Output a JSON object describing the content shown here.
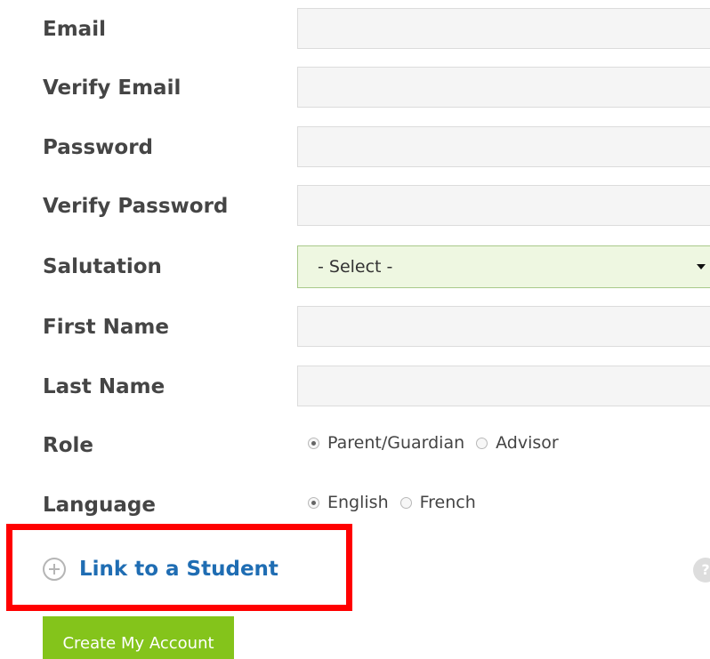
{
  "form": {
    "fields": {
      "email": {
        "label": "Email",
        "value": "",
        "placeholder": ""
      },
      "verify_email": {
        "label": "Verify Email",
        "value": "",
        "placeholder": ""
      },
      "password": {
        "label": "Password",
        "value": "",
        "placeholder": ""
      },
      "verify_password": {
        "label": "Verify Password",
        "value": "",
        "placeholder": ""
      },
      "salutation": {
        "label": "Salutation",
        "selected": "- Select -"
      },
      "first_name": {
        "label": "First Name",
        "value": "",
        "placeholder": ""
      },
      "last_name": {
        "label": "Last Name",
        "value": "",
        "placeholder": ""
      }
    },
    "role": {
      "label": "Role",
      "options": [
        {
          "label": "Parent/Guardian",
          "checked": true
        },
        {
          "label": "Advisor",
          "checked": false
        }
      ]
    },
    "language": {
      "label": "Language",
      "options": [
        {
          "label": "English",
          "checked": true
        },
        {
          "label": "French",
          "checked": false
        }
      ]
    },
    "link_student": {
      "label": "Link to a Student",
      "icon": "plus-circle-icon",
      "highlight_color": "#ff0000"
    },
    "help": {
      "label": "?",
      "icon": "question-icon"
    },
    "submit_label": "Create My Account"
  },
  "colors": {
    "input_background": "#f5f5f5",
    "input_border": "#dcdcdc",
    "select_background": "#eef7e1",
    "select_border": "#a8c98a",
    "link": "#1f6db3",
    "button": "#84c41b",
    "text": "#454545"
  }
}
